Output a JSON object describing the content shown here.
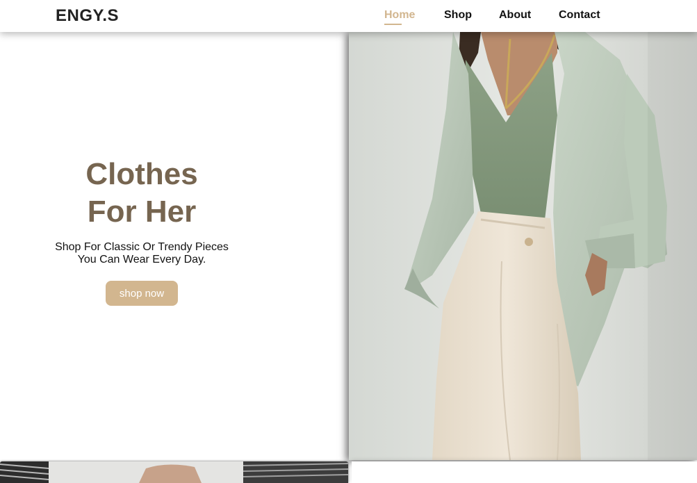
{
  "header": {
    "logo": "ENGY.S",
    "nav": [
      {
        "label": "Home",
        "active": true
      },
      {
        "label": "Shop",
        "active": false
      },
      {
        "label": "About",
        "active": false
      },
      {
        "label": "Contact",
        "active": false
      }
    ]
  },
  "hero": {
    "title_line1": "Clothes",
    "title_line2": "For Her",
    "subtitle_line1": "Shop For Classic Or Trendy Pieces",
    "subtitle_line2": "You Can Wear Every Day.",
    "button_label": "shop now"
  },
  "colors": {
    "accent": "#d2b68f",
    "title": "#766550",
    "text": "#111111"
  }
}
